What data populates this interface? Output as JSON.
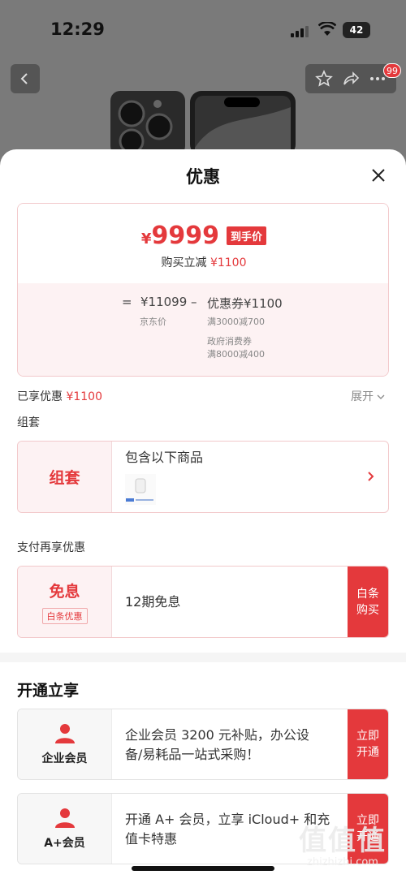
{
  "status_bar": {
    "time": "12:29",
    "battery": "42"
  },
  "header": {
    "badge": "99"
  },
  "sheet": {
    "title": "优惠",
    "price_card": {
      "currency": "¥",
      "price": "9999",
      "price_tag": "到手价",
      "reduce_label": "购买立减",
      "reduce_value": "¥1100",
      "eq_sign": "=",
      "jd_price": "¥11099",
      "jd_price_label": "京东价",
      "minus_sign": "–",
      "coupon": "优惠券¥1100",
      "coupon_detail_1": "满3000减700",
      "coupon_detail_2": "政府消费券",
      "coupon_detail_3": "满8000减400"
    },
    "enjoyed_label": "已享优惠",
    "enjoyed_value": "¥1100",
    "expand_label": "展开",
    "bundle": {
      "section_label": "组套",
      "left_title": "组套",
      "text": "包含以下商品"
    },
    "pay": {
      "section_label": "支付再享优惠",
      "left_title": "免息",
      "left_tag": "白条优惠",
      "text": "12期免息",
      "button": "白条购买"
    },
    "membership": {
      "title": "开通立享",
      "items": [
        {
          "name": "企业会员",
          "text_line1": "企业会员 3200 元补贴，办公设",
          "text_line2": "备/易耗品一站式采购！",
          "button": "立即开通"
        },
        {
          "name": "A+会员",
          "text_line1": "开通 A+ 会员，立享 iCloud+ 和充",
          "text_line2": "值卡特惠",
          "button": "立即开通"
        }
      ]
    }
  },
  "watermark": {
    "logo": "值值值",
    "url": "zhizhizhi.com"
  },
  "colors": {
    "accent": "#e4393c",
    "pink_bg": "#fdf2f3"
  }
}
